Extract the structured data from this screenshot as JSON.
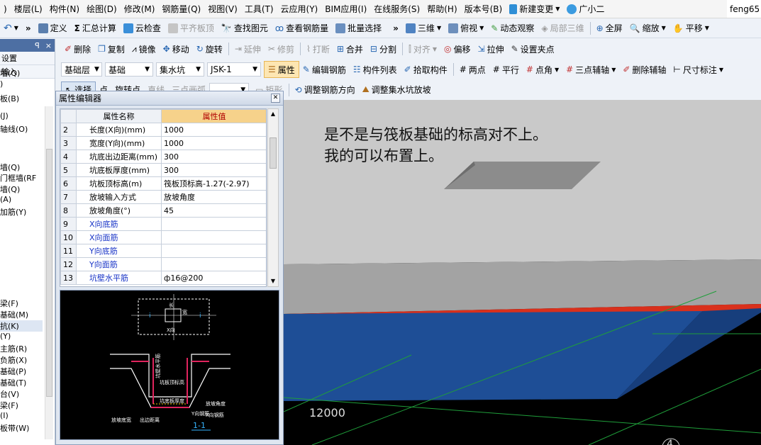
{
  "menubar": {
    "items": [
      ")",
      "楼层(L)",
      "构件(N)",
      "绘图(D)",
      "修改(M)",
      "钢筋量(Q)",
      "视图(V)",
      "工具(T)",
      "云应用(Y)",
      "BIM应用(I)",
      "在线服务(S)",
      "帮助(H)",
      "版本号(B)"
    ],
    "new_change": "新建变更",
    "helper": "广小二",
    "user": "feng65"
  },
  "toolbar1": {
    "items": [
      "定义",
      "汇总计算",
      "云检查",
      "平齐板顶",
      "查找图元",
      "查看钢筋量",
      "批量选择"
    ],
    "right_items": [
      "三维",
      "俯视",
      "动态观察",
      "局部三维",
      "全屏",
      "缩放",
      "平移"
    ]
  },
  "toolbar2": {
    "items": [
      "删除",
      "复制",
      "镜像",
      "移动",
      "旋转",
      "延伸",
      "修剪",
      "打断",
      "合并",
      "分割",
      "对齐",
      "偏移",
      "拉伸",
      "设置夹点"
    ]
  },
  "toolbar3": {
    "layer": "基础层",
    "category": "基础",
    "type": "集水坑",
    "element": "JSK-1",
    "items": [
      "属性",
      "编辑钢筋",
      "构件列表",
      "拾取构件",
      "两点",
      "平行",
      "点角",
      "三点辅轴",
      "删除辅轴",
      "尺寸标注"
    ]
  },
  "toolbar4": {
    "items": [
      "选择",
      "点",
      "旋转点",
      "直线",
      "三点画弧",
      "矩形",
      "调整钢筋方向",
      "调整集水坑放坡"
    ]
  },
  "left_panel": {
    "pin": "ꟼ",
    "close": "×",
    "rows": [
      "设置",
      "输入"
    ],
    "items": [
      "墙(Q)",
      ")",
      "板(B)",
      "(J)",
      "轴线(O)",
      "墙(Q)",
      "门框墙(RF",
      "墙(Q)",
      "(A)",
      "加筋(Y)",
      "梁(F)",
      "基础(M)",
      "抗(K)",
      "(Y)",
      "主筋(R)",
      "负筋(X)",
      "基础(P)",
      "基础(T)",
      "台(V)",
      "梁(F)",
      "(I)",
      "板带(W)"
    ]
  },
  "property_editor": {
    "title": "属性编辑器",
    "col_name": "属性名称",
    "col_value": "属性值",
    "rows": [
      {
        "n": "2",
        "name": "长度(X向)(mm)",
        "value": "1000",
        "blue": false
      },
      {
        "n": "3",
        "name": "宽度(Y向)(mm)",
        "value": "1000",
        "blue": false
      },
      {
        "n": "4",
        "name": "坑底出边距离(mm)",
        "value": "300",
        "blue": false
      },
      {
        "n": "5",
        "name": "坑底板厚度(mm)",
        "value": "300",
        "blue": false
      },
      {
        "n": "6",
        "name": "坑板顶标高(m)",
        "value": "筏板顶标高-1.27(-2.97)",
        "blue": false
      },
      {
        "n": "7",
        "name": "放坡输入方式",
        "value": "放坡角度",
        "blue": false
      },
      {
        "n": "8",
        "name": "放坡角度(°)",
        "value": "45",
        "blue": false
      },
      {
        "n": "9",
        "name": "X向底筋",
        "value": "",
        "blue": true
      },
      {
        "n": "10",
        "name": "X向面筋",
        "value": "",
        "blue": true
      },
      {
        "n": "11",
        "name": "Y向底筋",
        "value": "",
        "blue": true
      },
      {
        "n": "12",
        "name": "Y向面筋",
        "value": "",
        "blue": true
      },
      {
        "n": "13",
        "name": "坑壁水平筋",
        "value": "ф16@200",
        "blue": true
      }
    ],
    "diagram": {
      "labels": [
        "i",
        "宽",
        "长",
        "X向",
        "坑壁水平筋",
        "坑板顶标高",
        "坑底板厚度",
        "放坡角度",
        "Y向钢筋",
        "X向钢筋",
        "出边距离",
        "放坡底宽",
        "1-1"
      ]
    }
  },
  "viewport": {
    "annotation_line1": "是不是与筏板基础的标高对不上。",
    "annotation_line2": "我的可以布置上。",
    "dim_label": "12000",
    "axis_label": "4"
  },
  "colors": {
    "accent": "#4d6fa3",
    "highlight": "#f6d28b",
    "blue_text": "#1a35c7",
    "slab": "#1e4e96"
  }
}
